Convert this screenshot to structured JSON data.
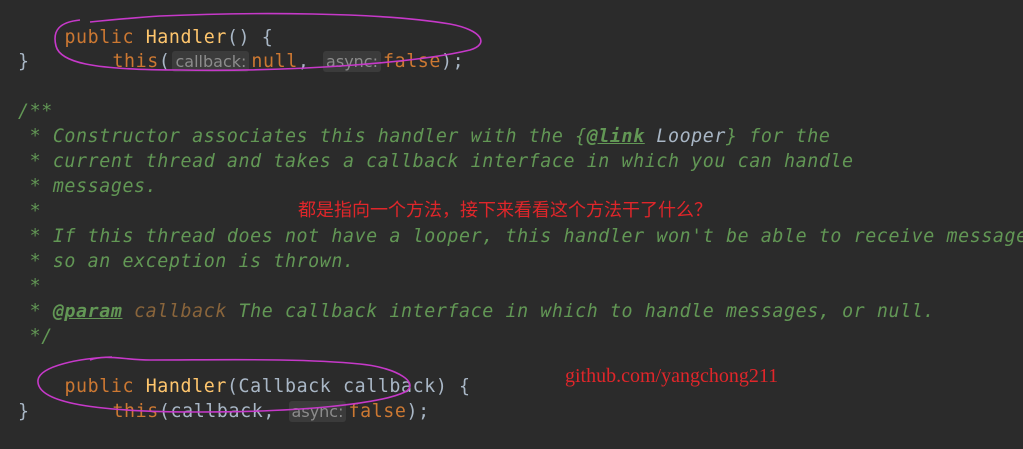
{
  "code": {
    "line1": {
      "public": "public",
      "name": "Handler",
      "rest": "() {"
    },
    "line2": {
      "this": "this",
      "open": "(",
      "hint_callback": "callback:",
      "null": "null",
      "comma": ",",
      "hint_async": "async:",
      "false": "false",
      "close": ");"
    },
    "line3": {
      "brace": "}"
    },
    "doc_open": "/**",
    "doc1": {
      "pre": " * Constructor associates this handler with the {",
      "link_tag": "@link",
      "ref": " Looper",
      "post": "} for the"
    },
    "doc2": " * current thread and takes a callback interface in which you can handle",
    "doc3": " * messages.",
    "doc4": " *",
    "doc5": " * If this thread does not have a looper, this handler won't be able to receive messages",
    "doc6": " * so an exception is thrown.",
    "doc7": " *",
    "doc8": {
      "pre": " * ",
      "tag": "@param",
      "name": "callback",
      "post": " The callback interface in which to handle messages, or null."
    },
    "doc_close": " */",
    "line_sig": {
      "public": "public",
      "name": "Handler",
      "rest": "(Callback callback) {"
    },
    "line_body": {
      "this": "this",
      "open": "(callback,",
      "hint_async": "async:",
      "false": "false",
      "close": ");"
    },
    "line_end": {
      "brace": "}"
    }
  },
  "annotations": {
    "chinese_note": "都是指向一个方法，接下来看看这个方法干了什么？",
    "url": "github.com/yangchong211",
    "ink_color": "#c639c9",
    "text_color": "#e0262a"
  }
}
